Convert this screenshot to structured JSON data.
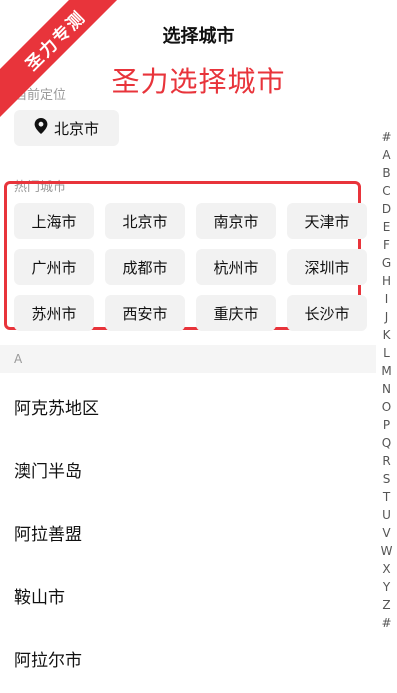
{
  "ribbon": {
    "text": "圣力专测"
  },
  "header": {
    "title": "选择城市"
  },
  "watermark": {
    "text": "圣力选择城市"
  },
  "current_location": {
    "label": "当前定位",
    "icon": "location-pin-icon",
    "city": "北京市"
  },
  "hot_cities": {
    "label": "热门城市",
    "items": [
      "上海市",
      "北京市",
      "南京市",
      "天津市",
      "广州市",
      "成都市",
      "杭州市",
      "深圳市",
      "苏州市",
      "西安市",
      "重庆市",
      "长沙市"
    ]
  },
  "index_bar": {
    "letters": [
      "#",
      "A",
      "B",
      "C",
      "D",
      "E",
      "F",
      "G",
      "H",
      "I",
      "J",
      "K",
      "L",
      "M",
      "N",
      "O",
      "P",
      "Q",
      "R",
      "S",
      "T",
      "U",
      "V",
      "W",
      "X",
      "Y",
      "Z",
      "#"
    ]
  },
  "city_list": {
    "section_letter": "A",
    "items": [
      "阿克苏地区",
      "澳门半岛",
      "阿拉善盟",
      "鞍山市",
      "阿拉尔市"
    ]
  },
  "colors": {
    "accent": "#e8343b",
    "chip_bg": "#f2f2f2"
  }
}
